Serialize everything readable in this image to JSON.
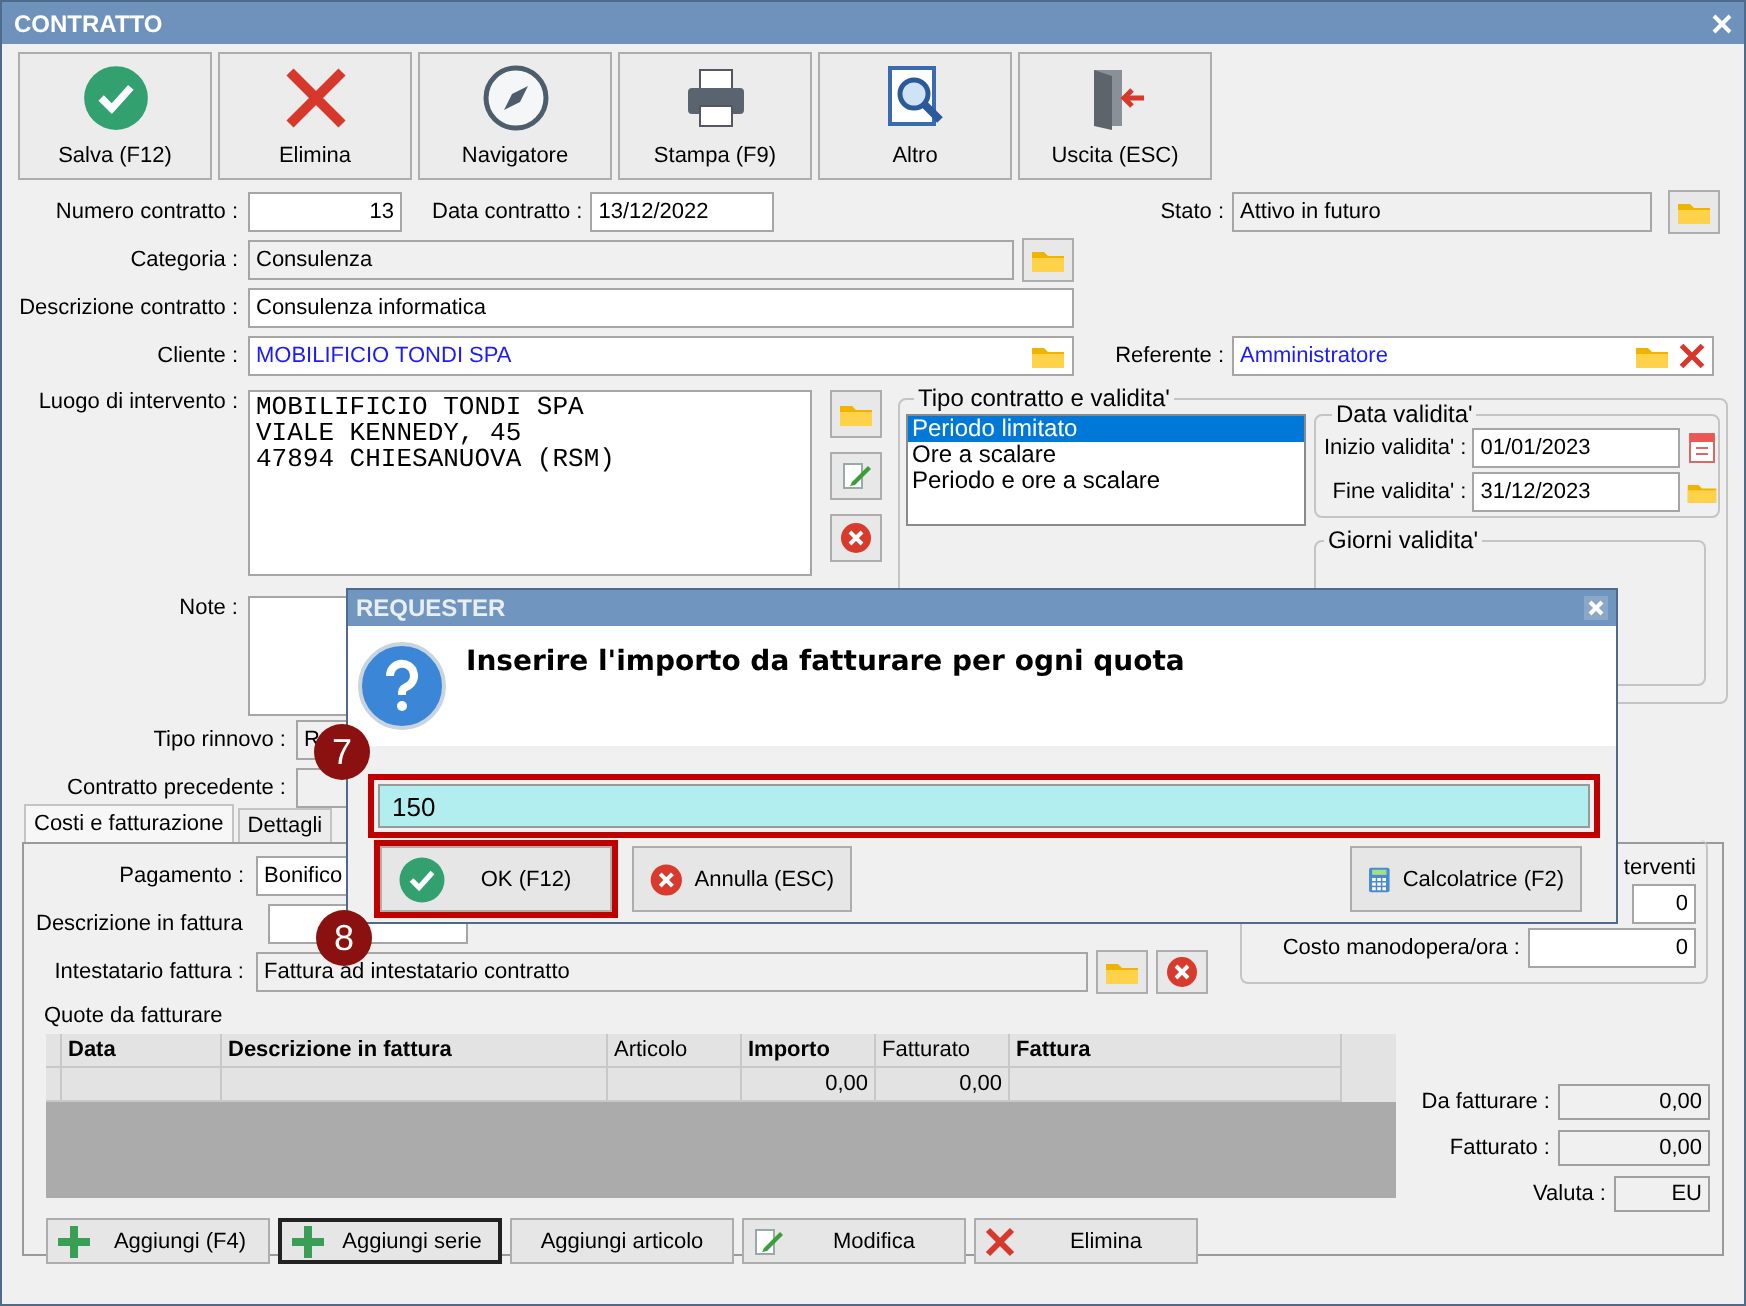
{
  "window": {
    "title": "CONTRATTO"
  },
  "toolbar": [
    {
      "label": "Salva (F12)",
      "kind": "save"
    },
    {
      "label": "Elimina",
      "kind": "delete"
    },
    {
      "label": "Navigatore",
      "kind": "navigator"
    },
    {
      "label": "Stampa (F9)",
      "kind": "print"
    },
    {
      "label": "Altro",
      "kind": "other"
    },
    {
      "label": "Uscita (ESC)",
      "kind": "exit"
    }
  ],
  "form": {
    "numero_contratto": {
      "label": "Numero contratto :",
      "value": "13"
    },
    "data_contratto": {
      "label": "Data contratto :",
      "value": "13/12/2022"
    },
    "stato": {
      "label": "Stato :",
      "value": "Attivo in futuro"
    },
    "categoria": {
      "label": "Categoria :",
      "value": "Consulenza"
    },
    "descrizione_contratto": {
      "label": "Descrizione contratto :",
      "value": "Consulenza informatica"
    },
    "cliente": {
      "label": "Cliente :",
      "value": "MOBILIFICIO TONDI SPA"
    },
    "referente": {
      "label": "Referente :",
      "value": "Amministratore"
    },
    "luogo_di_intervento": {
      "label": "Luogo di intervento :",
      "lines": [
        "MOBILIFICIO TONDI SPA",
        "VIALE KENNEDY, 45",
        "47894 CHIESANUOVA (RSM)"
      ]
    },
    "note": {
      "label": "Note :"
    },
    "tipo_rinnovo": {
      "label": "Tipo rinnovo :",
      "value": "R"
    },
    "contratto_precedente": {
      "label": "Contratto precedente :"
    }
  },
  "tipo_contratto": {
    "title": "Tipo contratto e validita'",
    "options": [
      {
        "label": "Periodo limitato",
        "selected": true
      },
      {
        "label": "Ore a scalare",
        "selected": false
      },
      {
        "label": "Periodo e ore a scalare",
        "selected": false
      }
    ]
  },
  "data_validita": {
    "title": "Data validita'",
    "fields": [
      {
        "label": "Inizio validita' :",
        "value": "01/01/2023",
        "kind": "calendar"
      },
      {
        "label": "Fine validita' :",
        "value": "31/12/2023",
        "kind": "folder"
      }
    ]
  },
  "giorni_validita": {
    "title": "Giorni validita'"
  },
  "tabs": [
    {
      "label": "Costi e fatturazione",
      "selected": true
    },
    {
      "label": "Dettagli",
      "selected": false
    }
  ],
  "billing": {
    "pagamento": {
      "label": "Pagamento :",
      "value": "Bonifico"
    },
    "descrizione_in_fattura": {
      "label": "Descrizione in fattura"
    },
    "intestatario": {
      "label": "Intestatario fattura :",
      "value": "Fattura ad intestatario contratto"
    },
    "interventi": {
      "title": "terventi",
      "value": "0"
    },
    "costo_manodopera": {
      "label": "Costo manodopera/ora :",
      "value": "0"
    },
    "quote_title": "Quote da fatturare",
    "columns": [
      {
        "label": "Data",
        "bold": true
      },
      {
        "label": "Descrizione in fattura",
        "bold": true
      },
      {
        "label": "Articolo",
        "bold": false
      },
      {
        "label": "Importo",
        "bold": true
      },
      {
        "label": "Fatturato",
        "bold": false
      },
      {
        "label": "Fattura",
        "bold": true
      }
    ],
    "rows": [
      {
        "importo": "0,00",
        "fatturato": "0,00"
      }
    ],
    "totals": [
      {
        "label": "Da fatturare :",
        "value": "0,00"
      },
      {
        "label": "Fatturato :",
        "value": "0,00"
      },
      {
        "label": "Valuta :",
        "value": "EU"
      }
    ],
    "buttons": [
      {
        "label": "Aggiungi (F4)",
        "kind": "add",
        "focused": false
      },
      {
        "label": "Aggiungi serie",
        "kind": "add",
        "focused": true
      },
      {
        "label": "Aggiungi articolo",
        "kind": "plain",
        "focused": false
      },
      {
        "label": "Modifica",
        "kind": "edit",
        "focused": false
      },
      {
        "label": "Elimina",
        "kind": "delete",
        "focused": false
      }
    ]
  },
  "requester": {
    "title": "REQUESTER",
    "message": "Inserire l'importo da fatturare per ogni quota",
    "value": "150",
    "highlighted": true,
    "buttons": [
      {
        "label": "OK (F12)",
        "kind": "ok",
        "highlighted": true
      },
      {
        "label": "Annulla (ESC)",
        "kind": "cancel",
        "highlighted": false
      },
      {
        "label": "Calcolatrice (F2)",
        "kind": "calculator",
        "highlighted": false
      }
    ]
  },
  "annotations": [
    {
      "label": "7"
    },
    {
      "label": "8"
    }
  ]
}
